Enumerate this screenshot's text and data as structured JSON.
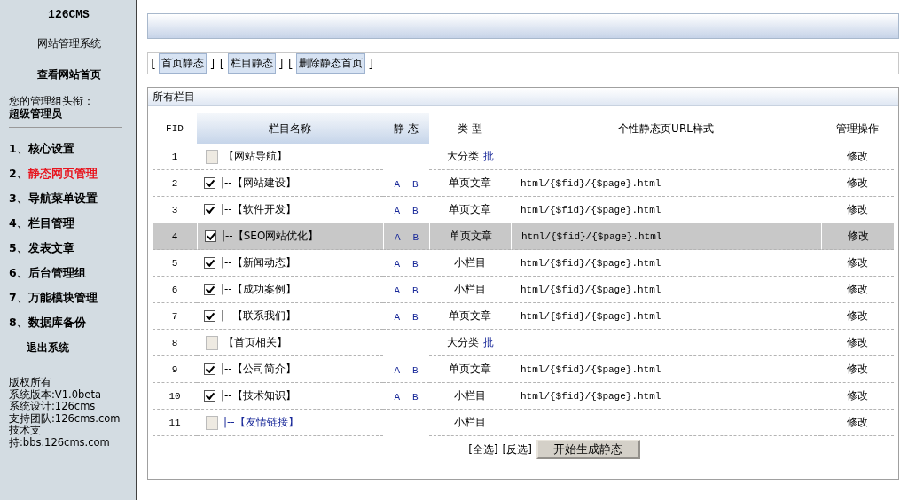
{
  "sidebar": {
    "title": "126CMS",
    "subtitle": "网站管理系统",
    "home_link": "查看网站首页",
    "group_label": "您的管理组头衔：",
    "group_value": "超级管理员",
    "menu": [
      {
        "number": "1、",
        "label": "核心设置",
        "selected": false
      },
      {
        "number": "2、",
        "label": "静态网页管理",
        "selected": true
      },
      {
        "number": "3、",
        "label": "导航菜单设置",
        "selected": false
      },
      {
        "number": "4、",
        "label": "栏目管理",
        "selected": false
      },
      {
        "number": "5、",
        "label": "发表文章",
        "selected": false
      },
      {
        "number": "6、",
        "label": "后台管理组",
        "selected": false
      },
      {
        "number": "7、",
        "label": "万能模块管理",
        "selected": false
      },
      {
        "number": "8、",
        "label": "数据库备份",
        "selected": false
      }
    ],
    "logout": "退出系统",
    "footer": [
      "版权所有",
      "系统版本:V1.0beta",
      "系统设计:126cms",
      "支持团队:126cms.com",
      "技术支",
      "持:bbs.126cms.com"
    ]
  },
  "toolbar": [
    {
      "before": "[",
      "label": "首页静态",
      "after": "]"
    },
    {
      "before": "[",
      "label": "栏目静态",
      "after": "]"
    },
    {
      "before": "[",
      "label": "删除静态首页",
      "after": "]"
    }
  ],
  "panel": {
    "title": "所有栏目",
    "columns": [
      "FID",
      "栏目名称",
      "静 态",
      "类 型",
      "个性静态页URL样式",
      "管理操作"
    ],
    "rows": [
      {
        "kind": "category",
        "fid": "1",
        "checked": false,
        "name": "【网站导航】",
        "type": "大分类",
        "batch": "批",
        "action": "修改",
        "selected": false
      },
      {
        "kind": "sub",
        "fid": "2",
        "checked": true,
        "name": "|--【网站建设】",
        "static": [
          "A",
          "B"
        ],
        "type": "单页文章",
        "url": "html/{$fid}/{$page}.html",
        "action": "修改",
        "selected": false
      },
      {
        "kind": "sub",
        "fid": "3",
        "checked": true,
        "name": "|--【软件开发】",
        "static": [
          "A",
          "B"
        ],
        "type": "单页文章",
        "url": "html/{$fid}/{$page}.html",
        "action": "修改",
        "selected": false
      },
      {
        "kind": "sub",
        "fid": "4",
        "checked": true,
        "name": "|--【SEO网站优化】",
        "static": [
          "A",
          "B"
        ],
        "type": "单页文章",
        "url": "html/{$fid}/{$page}.html",
        "action": "修改",
        "selected": true
      },
      {
        "kind": "sub",
        "fid": "5",
        "checked": true,
        "name": "|--【新闻动态】",
        "static": [
          "A",
          "B"
        ],
        "type": "小栏目",
        "url": "html/{$fid}/{$page}.html",
        "action": "修改",
        "selected": false
      },
      {
        "kind": "sub",
        "fid": "6",
        "checked": true,
        "name": "|--【成功案例】",
        "static": [
          "A",
          "B"
        ],
        "type": "小栏目",
        "url": "html/{$fid}/{$page}.html",
        "action": "修改",
        "selected": false
      },
      {
        "kind": "sub",
        "fid": "7",
        "checked": true,
        "name": "|--【联系我们】",
        "static": [
          "A",
          "B"
        ],
        "type": "单页文章",
        "url": "html/{$fid}/{$page}.html",
        "action": "修改",
        "selected": false
      },
      {
        "kind": "category",
        "fid": "8",
        "checked": false,
        "name": "【首页相关】",
        "type": "大分类",
        "batch": "批",
        "action": "修改",
        "selected": false
      },
      {
        "kind": "sub",
        "fid": "9",
        "checked": true,
        "name": "|--【公司简介】",
        "static": [
          "A",
          "B"
        ],
        "type": "单页文章",
        "url": "html/{$fid}/{$page}.html",
        "action": "修改",
        "selected": false
      },
      {
        "kind": "sub",
        "fid": "10",
        "checked": true,
        "name": "|--【技术知识】",
        "static": [
          "A",
          "B"
        ],
        "type": "小栏目",
        "url": "html/{$fid}/{$page}.html",
        "action": "修改",
        "selected": false
      },
      {
        "kind": "link",
        "fid": "11",
        "checked": false,
        "name": "|--【友情链接】",
        "type": "小栏目",
        "action": "修改",
        "selected": false
      }
    ],
    "select_all": "[全选]",
    "invert": "[反选]",
    "submit": "开始生成静态"
  }
}
